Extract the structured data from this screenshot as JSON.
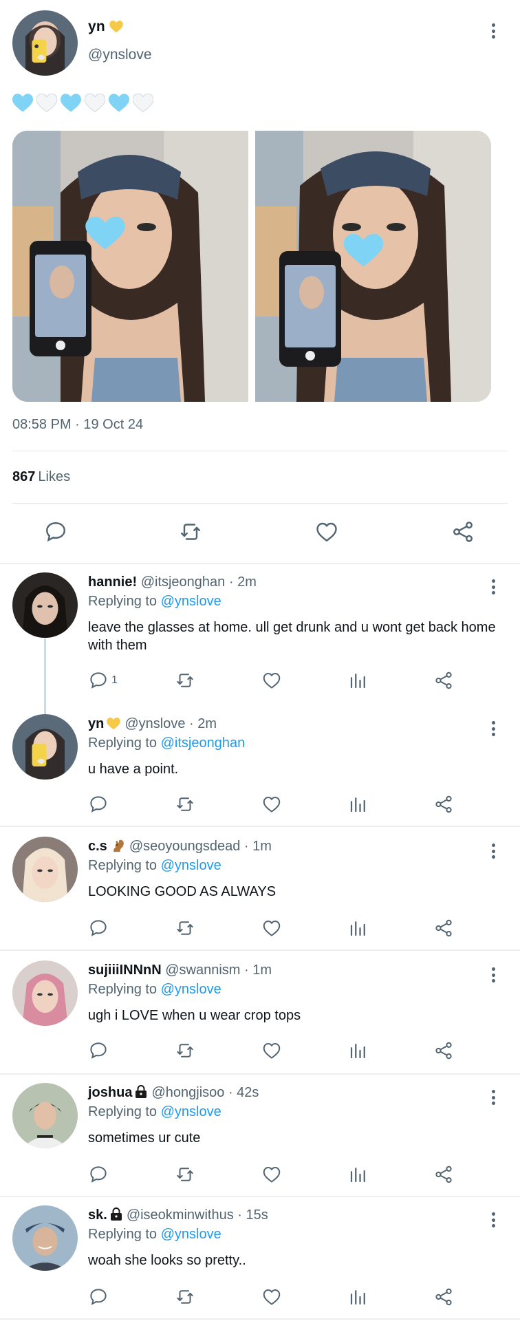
{
  "post": {
    "author_name": "yn",
    "author_handle": "@ynslove",
    "text_emojis": [
      "blue-heart",
      "white-heart",
      "blue-heart",
      "white-heart",
      "blue-heart",
      "white-heart"
    ],
    "timestamp": "08:58 PM · 19 Oct 24",
    "likes_count": "867",
    "likes_label": "Likes",
    "actions": [
      "reply-icon",
      "retweet-icon",
      "like-icon",
      "share-icon"
    ]
  },
  "replies": [
    {
      "name": "hannie!",
      "name_emoji": "",
      "handle": "@itsjeonghan",
      "time": "2m",
      "replying_prefix": "Replying to",
      "replying_to": "@ynslove",
      "text": "leave the glasses at home. ull get drunk and u wont get back home with them",
      "reply_count": "1"
    },
    {
      "name": "yn",
      "name_emoji": "yellow-heart",
      "handle": "@ynslove",
      "time": "2m",
      "replying_prefix": "Replying to",
      "replying_to": "@itsjeonghan",
      "text": "u have a point.",
      "reply_count": ""
    },
    {
      "name": "c.s",
      "name_emoji": "squirrel",
      "handle": "@seoyoungsdead",
      "time": "1m",
      "replying_prefix": "Replying to",
      "replying_to": "@ynslove",
      "text": "LOOKING GOOD AS ALWAYS",
      "reply_count": ""
    },
    {
      "name": "sujiiiINNnN",
      "name_emoji": "",
      "handle": "@swannism",
      "time": "1m",
      "replying_prefix": "Replying to",
      "replying_to": "@ynslove",
      "text": "ugh i LOVE when u wear crop tops",
      "reply_count": ""
    },
    {
      "name": "joshua",
      "name_emoji": "lock",
      "handle": "@hongjisoo",
      "time": "42s",
      "replying_prefix": "Replying to",
      "replying_to": "@ynslove",
      "text": "sometimes ur cute",
      "reply_count": ""
    },
    {
      "name": "sk.",
      "name_emoji": "lock",
      "handle": "@iseokminwithus",
      "time": "15s",
      "replying_prefix": "Replying to",
      "replying_to": "@ynslove",
      "text": "woah she looks so pretty..",
      "reply_count": ""
    }
  ],
  "colors": {
    "accent": "#1d9bf0",
    "muted_text": "#536471",
    "primary_text": "#0f1419",
    "blue_heart": "#7fd3f5",
    "yellow_heart": "#f7c948"
  }
}
